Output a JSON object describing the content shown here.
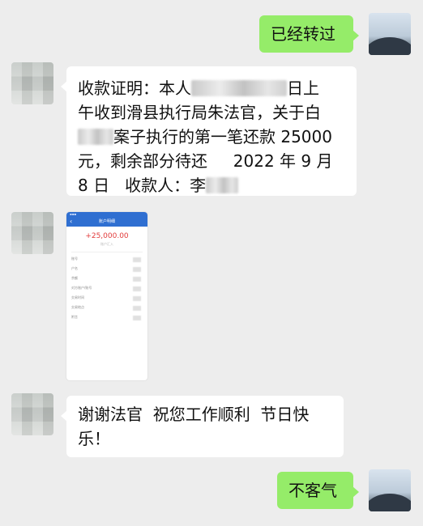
{
  "messages": {
    "m1": {
      "text": "已经转过"
    },
    "m2": {
      "l1_a": "收款证明：本人",
      "l1_b": "日上",
      "l2": "午收到滑县执行局朱法官，关于白",
      "l3": "案子执行的第一笔还款 25000",
      "l4": "元，剩余部分待还     2022 年 9 月",
      "l5": "8 日   收款人：李"
    },
    "m3": {
      "header": "账户明细",
      "amount": "+25,000.00",
      "sub": "账户汇入",
      "rows": [
        "账号",
        "户名",
        "余额",
        "对方账户/账号",
        "交易时间",
        "交易地点",
        "附言"
      ]
    },
    "m4": {
      "l1": "谢谢法官  祝您工作顺利  节日快",
      "l2": "乐！"
    },
    "m5": {
      "text": "不客气"
    }
  },
  "colors": {
    "sent_bubble": "#95ec69",
    "received_bubble": "#ffffff",
    "chat_bg": "#ededed",
    "amount_red": "#e23b3b",
    "bank_blue": "#2f6fd1"
  },
  "avatars": {
    "self": "mountain-avatar",
    "other": "pixelated-avatar"
  }
}
